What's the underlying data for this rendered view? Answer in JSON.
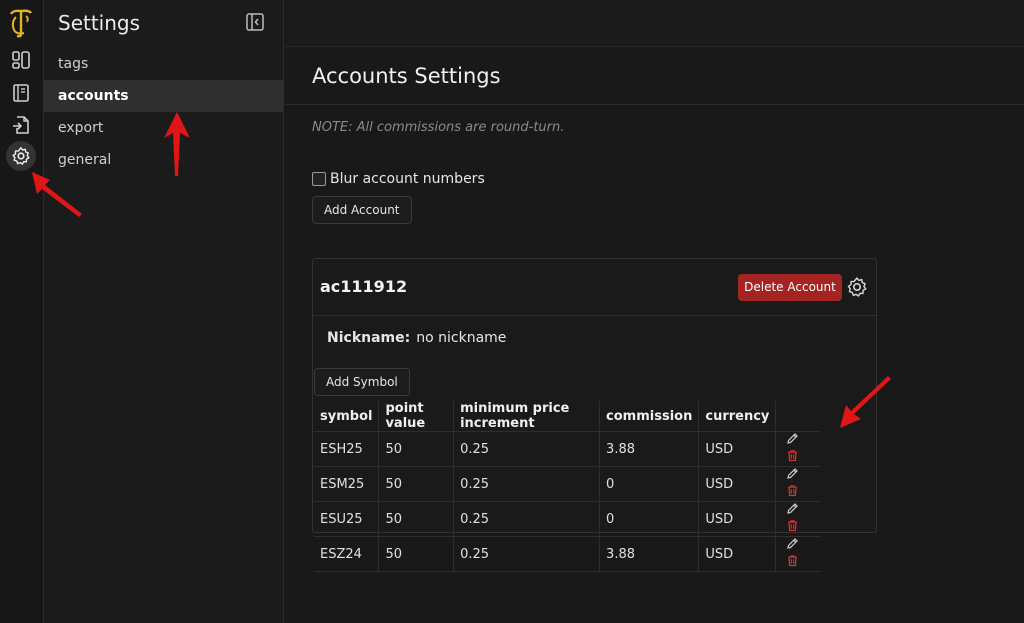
{
  "sidebar": {
    "title": "Settings",
    "items": [
      {
        "label": "tags"
      },
      {
        "label": "accounts"
      },
      {
        "label": "export"
      },
      {
        "label": "general"
      }
    ]
  },
  "main": {
    "title": "Accounts Settings",
    "note": "NOTE: All commissions are round-turn.",
    "blur_label": "Blur account numbers",
    "add_account_label": "Add Account"
  },
  "account": {
    "id": "ac111912",
    "delete_label": "Delete Account",
    "nickname_label": "Nickname:",
    "nickname_value": "no nickname",
    "add_symbol_label": "Add Symbol",
    "columns": [
      "symbol",
      "point value",
      "minimum price increment",
      "commission",
      "currency"
    ],
    "rows": [
      [
        "ESH25",
        "50",
        "0.25",
        "3.88",
        "USD"
      ],
      [
        "ESM25",
        "50",
        "0.25",
        "0",
        "USD"
      ],
      [
        "ESU25",
        "50",
        "0.25",
        "0",
        "USD"
      ],
      [
        "ESZ24",
        "50",
        "0.25",
        "3.88",
        "USD"
      ]
    ]
  },
  "colors": {
    "background": "#191919",
    "danger": "#a42424",
    "annotation_arrow": "#e01616",
    "logo": "#e6b422"
  }
}
